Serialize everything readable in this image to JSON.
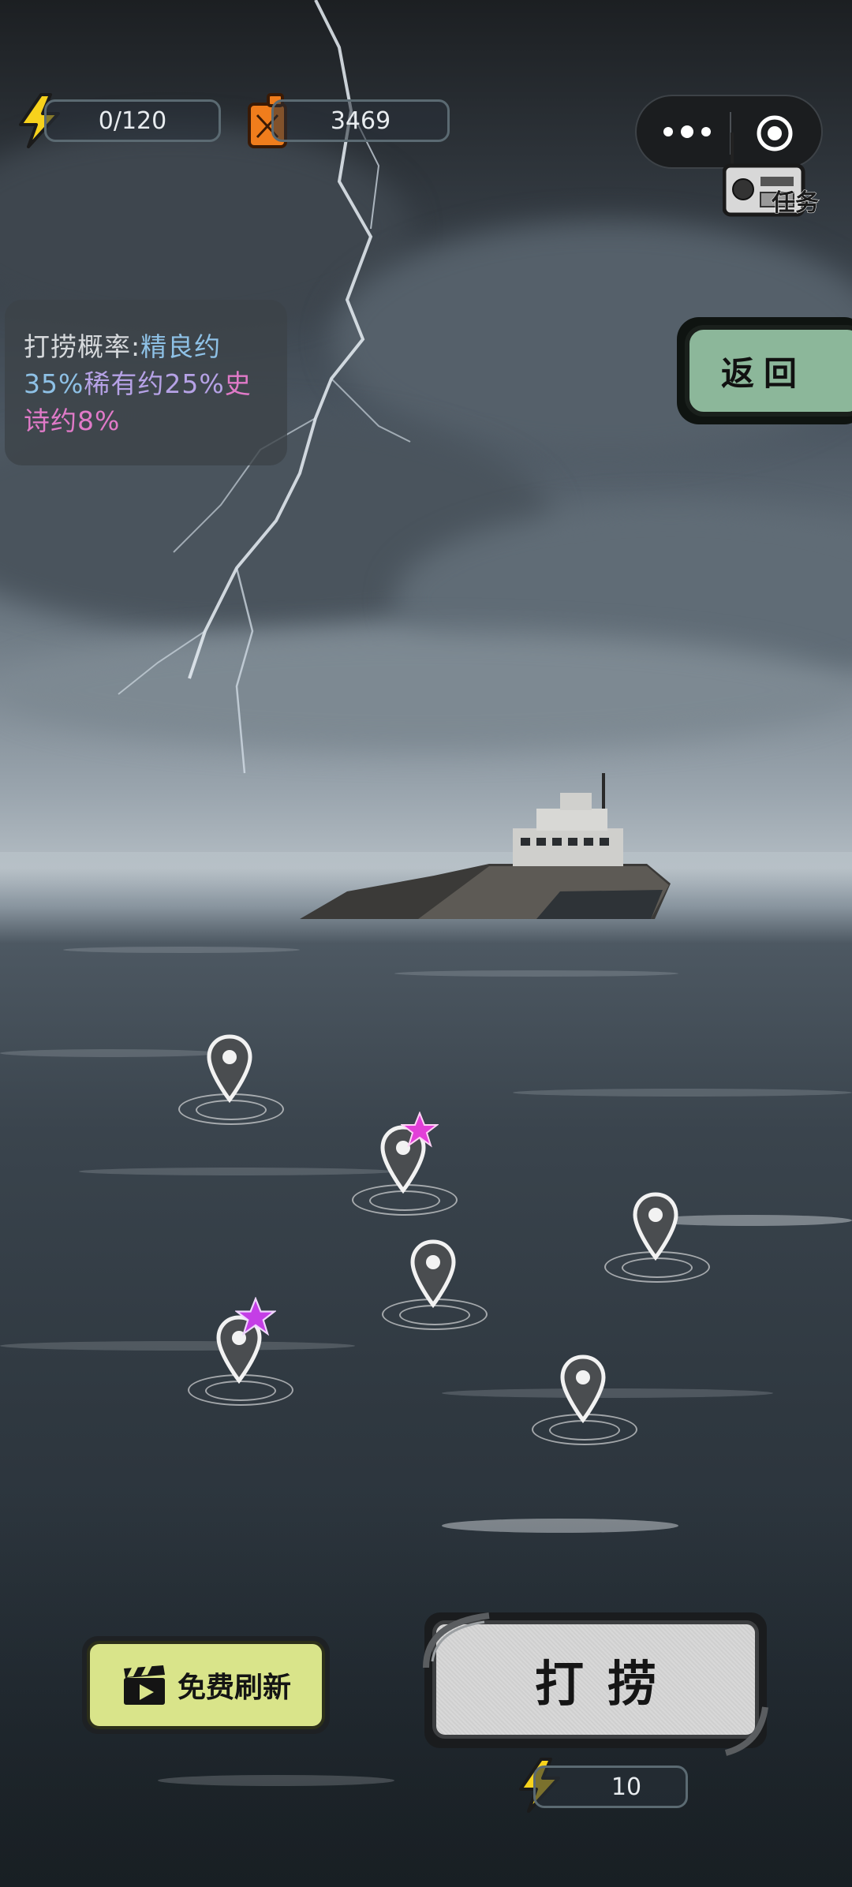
{
  "resources": {
    "energy": {
      "value": "0/120",
      "icon": "lightning-bolt-icon"
    },
    "fuel": {
      "value": "3469",
      "icon": "fuel-can-icon"
    }
  },
  "miniprogram_capsule": {
    "more_icon": "more-dots-icon",
    "close_icon": "target-circle-icon"
  },
  "tasks": {
    "label": "任务",
    "icon": "radio-icon"
  },
  "probability": {
    "prefix": "打捞概率:",
    "good": "精良约35%",
    "rare": "稀有约25%",
    "epic": "史诗约8%"
  },
  "back_button": {
    "label": "返回"
  },
  "markers": [
    {
      "id": 1,
      "starred": false
    },
    {
      "id": 2,
      "starred": true
    },
    {
      "id": 3,
      "starred": false
    },
    {
      "id": 4,
      "starred": false
    },
    {
      "id": 5,
      "starred": true
    },
    {
      "id": 6,
      "starred": false
    }
  ],
  "free_refresh": {
    "label": "免费刷新",
    "icon": "clapperboard-icon"
  },
  "salvage": {
    "label": "打捞",
    "cost": "10",
    "cost_icon": "lightning-bolt-icon"
  },
  "colors": {
    "good": "#8ec1e6",
    "rare": "#b6a2e6",
    "epic": "#e07ac8",
    "back_button": "#8cb79a",
    "free_button": "#d9e48a",
    "star": "#e23fd8"
  }
}
